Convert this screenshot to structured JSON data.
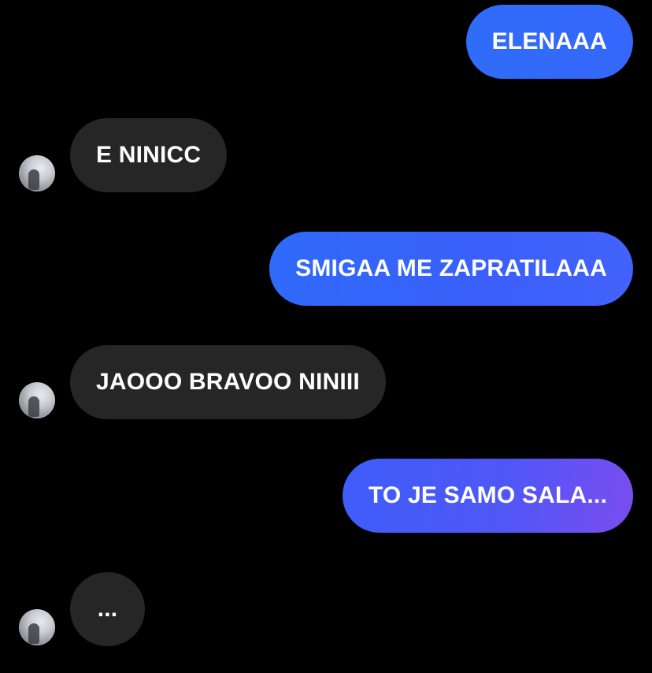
{
  "messages": [
    {
      "side": "outgoing",
      "text": "ELENAAA"
    },
    {
      "side": "incoming",
      "text": "E NINICC"
    },
    {
      "side": "outgoing",
      "text": "SMIGAA ME ZAPRATILAAA"
    },
    {
      "side": "incoming",
      "text": "JAOOO BRAVOO NINIII"
    },
    {
      "side": "outgoing",
      "text": "TO JE SAMO SALA..."
    },
    {
      "side": "incoming",
      "text": "..."
    }
  ],
  "colors": {
    "background": "#000000",
    "incoming_bubble": "#262626",
    "outgoing_bubble_start": "#2f6cf8",
    "outgoing_bubble_end": "#7b4cf0",
    "text": "#ffffff"
  }
}
